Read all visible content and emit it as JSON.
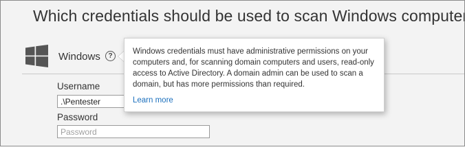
{
  "header": {
    "title": "Which credentials should be used to scan Windows computers?"
  },
  "windows_section": {
    "label": "Windows",
    "help_symbol": "?",
    "icon": "windows-logo-icon"
  },
  "form": {
    "username_label": "Username",
    "username_value": ".\\Pentester",
    "password_label": "Password",
    "password_placeholder": "Password"
  },
  "tooltip": {
    "body": "Windows credentials must have administrative permissions on your computers and, for scanning domain computers and users, read-only access to Active Directory. A domain admin can be used to scan a domain, but has more permissions than required.",
    "link_label": "Learn more"
  },
  "colors": {
    "background": "#f3f3f3",
    "link": "#1a6fbd",
    "text": "#333333"
  }
}
